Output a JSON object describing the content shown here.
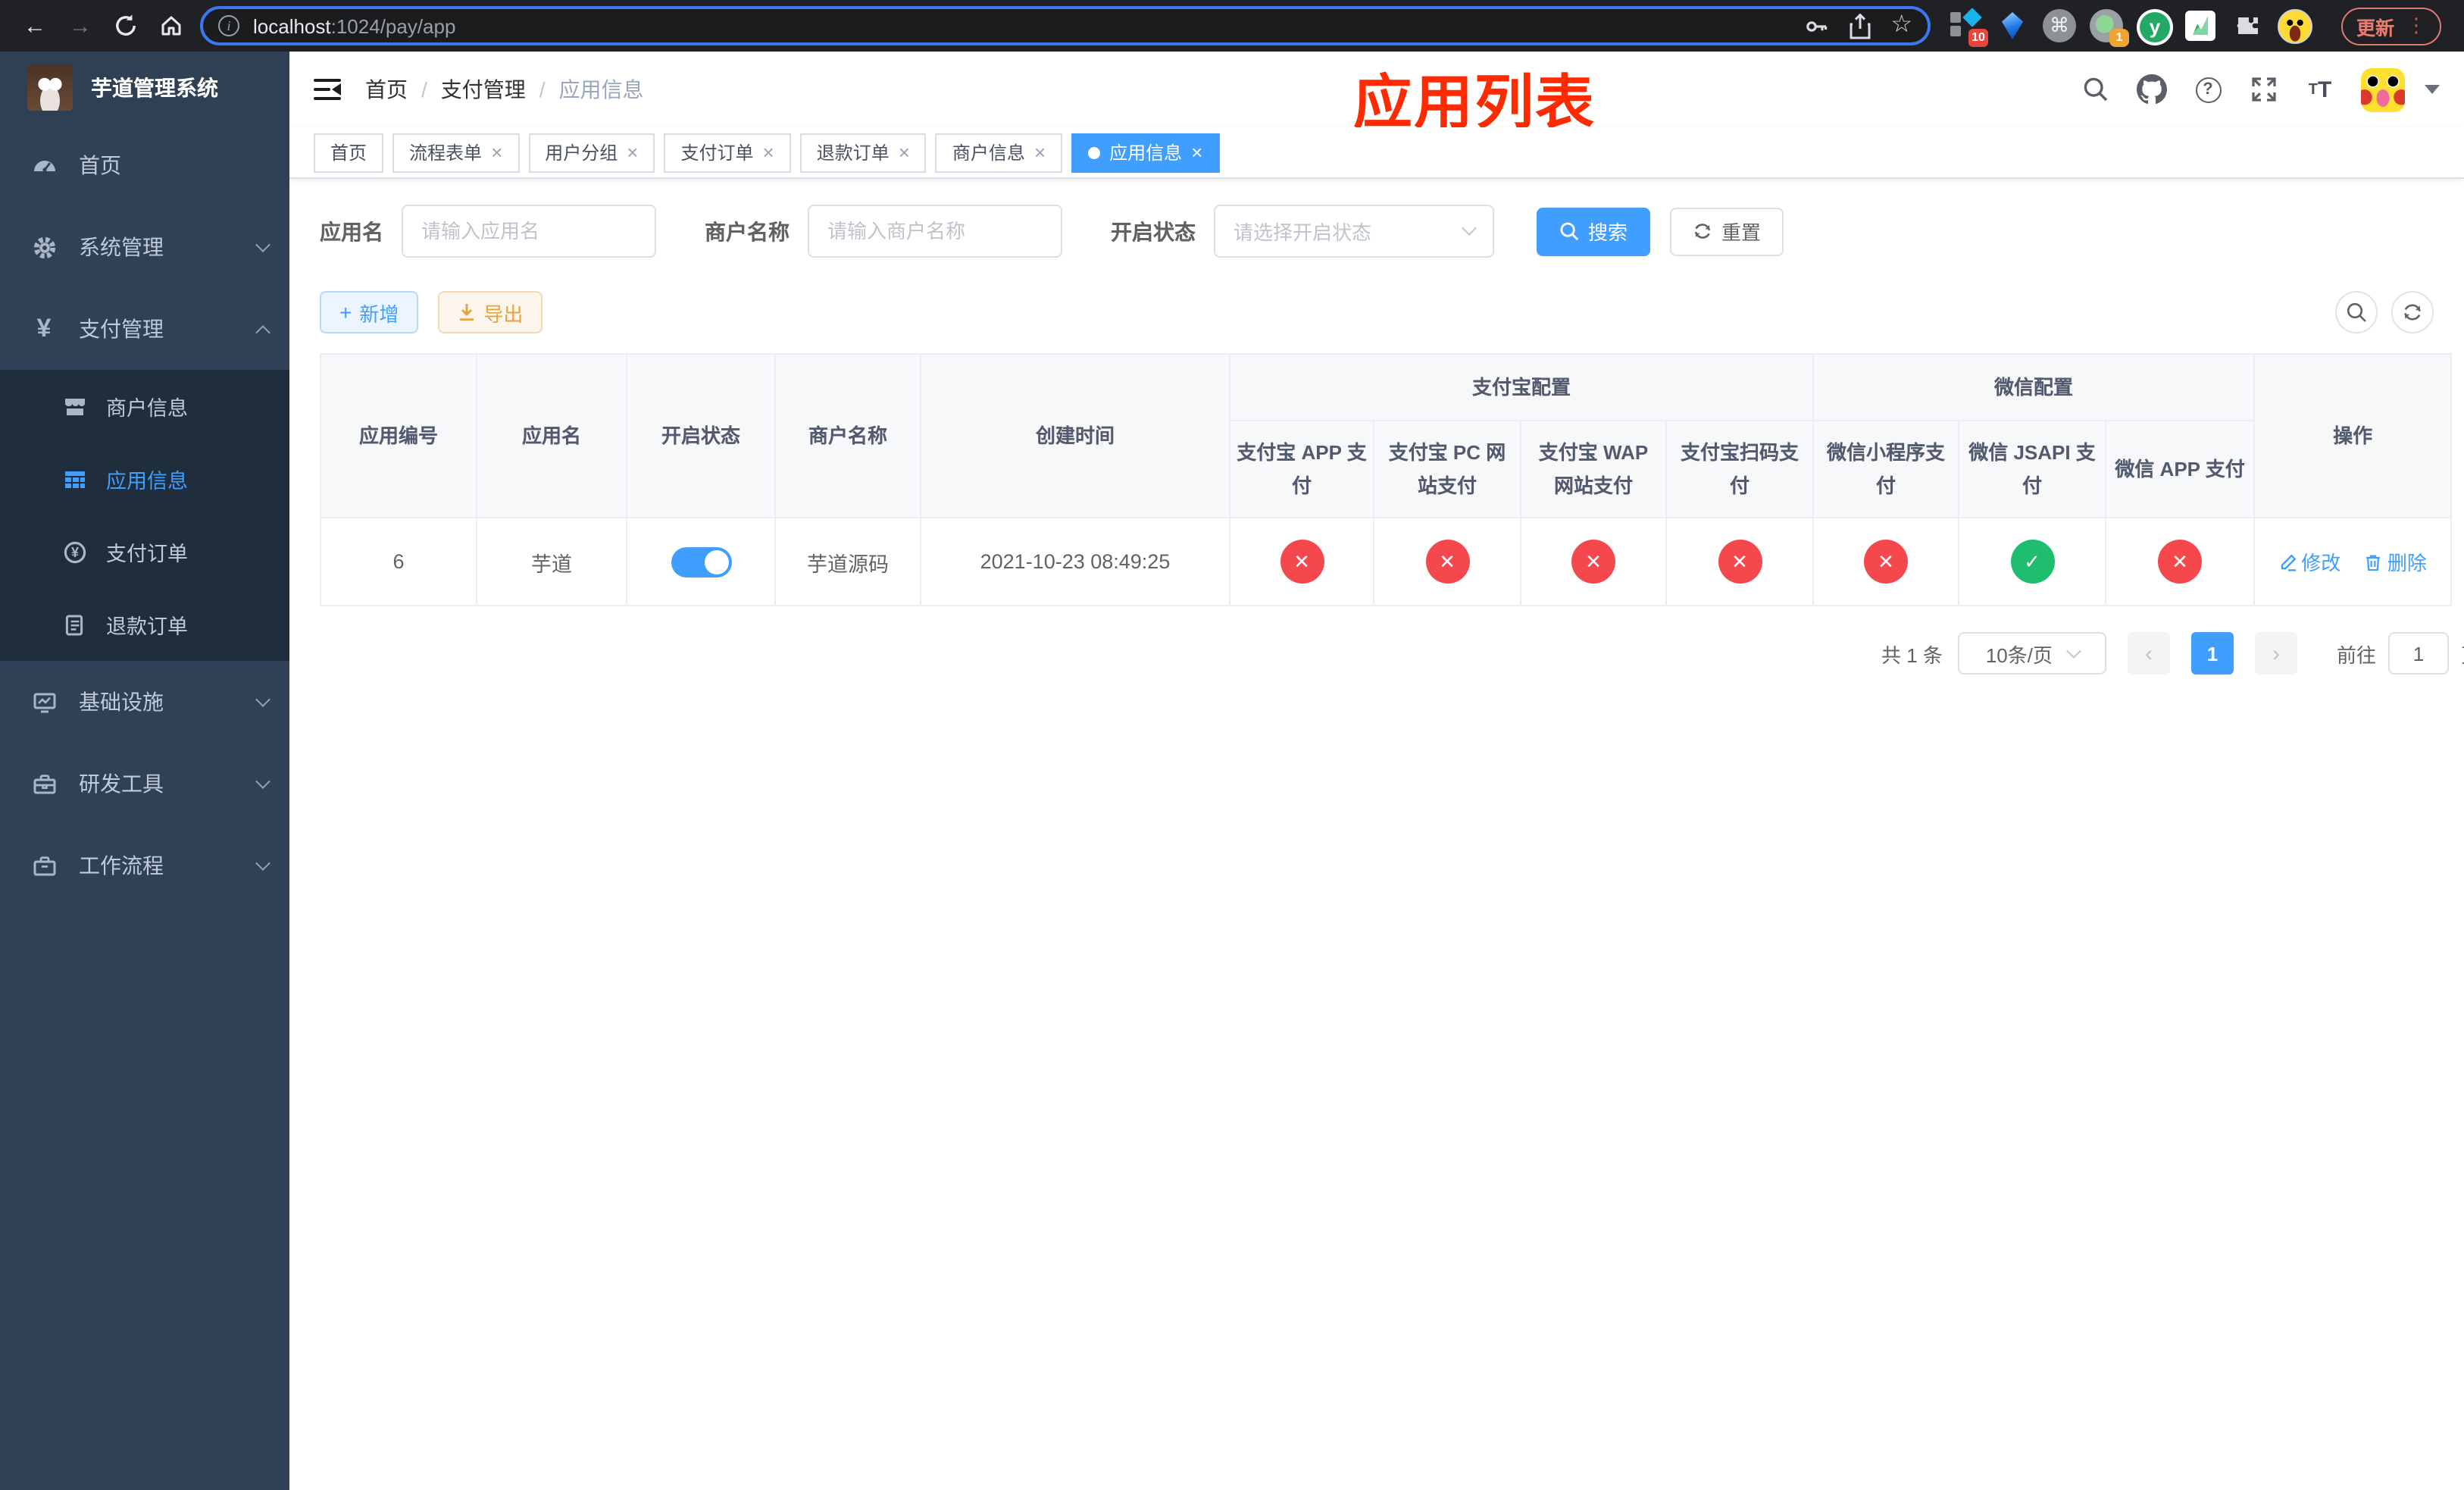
{
  "browser": {
    "url": {
      "host": "localhost",
      "rest": ":1024/pay/app"
    },
    "update_label": "更新",
    "badges": {
      "ext1": "10",
      "ext2": "1"
    }
  },
  "sidebar": {
    "title": "芋道管理系统",
    "menu": [
      {
        "label": "首页"
      },
      {
        "label": "系统管理"
      },
      {
        "label": "支付管理"
      },
      {
        "label": "基础设施"
      },
      {
        "label": "研发工具"
      },
      {
        "label": "工作流程"
      }
    ],
    "submenu": [
      {
        "label": "商户信息"
      },
      {
        "label": "应用信息"
      },
      {
        "label": "支付订单"
      },
      {
        "label": "退款订单"
      }
    ]
  },
  "navbar": {
    "breadcrumb": [
      "首页",
      "支付管理",
      "应用信息"
    ],
    "annotation": "应用列表"
  },
  "tabs": [
    {
      "label": "首页"
    },
    {
      "label": "流程表单"
    },
    {
      "label": "用户分组"
    },
    {
      "label": "支付订单"
    },
    {
      "label": "退款订单"
    },
    {
      "label": "商户信息"
    },
    {
      "label": "应用信息"
    }
  ],
  "filters": {
    "app_name": {
      "label": "应用名",
      "placeholder": "请输入应用名"
    },
    "merchant_name": {
      "label": "商户名称",
      "placeholder": "请输入商户名称"
    },
    "status": {
      "label": "开启状态",
      "placeholder": "请选择开启状态"
    },
    "search_label": "搜索",
    "reset_label": "重置"
  },
  "toolbar": {
    "add_label": "新增",
    "export_label": "导出"
  },
  "table": {
    "groups": {
      "alipay": "支付宝配置",
      "wechat": "微信配置"
    },
    "columns": {
      "app_id": "应用编号",
      "app_name": "应用名",
      "status": "开启状态",
      "merchant": "商户名称",
      "created": "创建时间",
      "alipay_app": "支付宝 APP 支付",
      "alipay_pc": "支付宝 PC 网站支付",
      "alipay_wap": "支付宝 WAP 网站支付",
      "alipay_qr": "支付宝扫码支付",
      "wx_mini": "微信小程序支付",
      "wx_jsapi": "微信 JSAPI 支付",
      "wx_app": "微信 APP 支付",
      "actions": "操作"
    },
    "row": {
      "app_id": "6",
      "app_name": "芋道",
      "status_on": true,
      "merchant": "芋道源码",
      "created": "2021-10-23 08:49:25",
      "configs": [
        "fail",
        "fail",
        "fail",
        "fail",
        "fail",
        "success",
        "fail"
      ],
      "edit_label": "修改",
      "delete_label": "删除"
    }
  },
  "pagination": {
    "total": "共 1 条",
    "page_size": "10条/页",
    "page": "1",
    "goto_label": "前往",
    "page_unit": "页"
  },
  "colors": {
    "primary": "#409eff",
    "success": "#1ebe6e",
    "danger": "#f5484d",
    "annotation": "#ff2a00"
  }
}
